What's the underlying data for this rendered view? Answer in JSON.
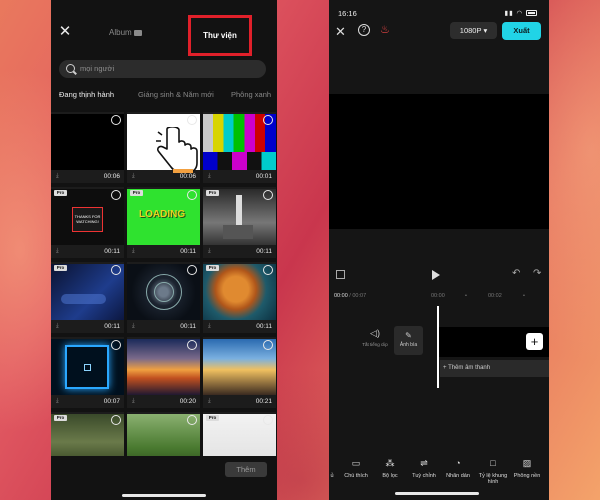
{
  "colors": {
    "highlight_border": "#e0202a",
    "export_button": "#21d4e6",
    "phone_bg": "#121212"
  },
  "left_screen": {
    "close_icon": "close-icon",
    "album_label": "Album",
    "library_label": "Thư viện",
    "search_placeholder": "mọi người",
    "categories": [
      "Đang thịnh hành",
      "Giáng sinh & Năm mới",
      "Phông xanh"
    ],
    "tiles": [
      {
        "duration": "00:06",
        "pro": false
      },
      {
        "duration": "00:06",
        "pro": false
      },
      {
        "duration": "00:01",
        "pro": false
      },
      {
        "duration": "00:11",
        "pro": true,
        "caption": "THANKS FOR WATCHING!"
      },
      {
        "duration": "00:11",
        "pro": true,
        "caption": "LOADING"
      },
      {
        "duration": "00:11",
        "pro": true
      },
      {
        "duration": "00:11",
        "pro": true
      },
      {
        "duration": "00:11",
        "pro": false
      },
      {
        "duration": "00:11",
        "pro": true
      },
      {
        "duration": "00:07",
        "pro": false
      },
      {
        "duration": "00:20",
        "pro": false
      },
      {
        "duration": "00:21",
        "pro": false
      },
      {
        "duration": "",
        "pro": true
      },
      {
        "duration": "",
        "pro": false
      },
      {
        "duration": "",
        "pro": true
      }
    ],
    "pro_badge": "Pro",
    "add_button": "Thêm"
  },
  "right_screen": {
    "status_time": "16:16",
    "resolution": "1080P",
    "export_label": "Xuất",
    "timecode_current": "00:00",
    "timecode_total": "00:07",
    "ruler_marks": [
      "00:00",
      "00:02"
    ],
    "audio_toggle_label": "Tắt tiếng clip",
    "cover_label": "Ảnh bìa",
    "add_audio_label": "Thêm âm thanh",
    "tools": [
      "ủ",
      "Chú thích",
      "Bộ lọc",
      "Tuỳ chỉnh",
      "Nhãn dán",
      "Tỷ lệ khung hình",
      "Phông nền"
    ]
  }
}
